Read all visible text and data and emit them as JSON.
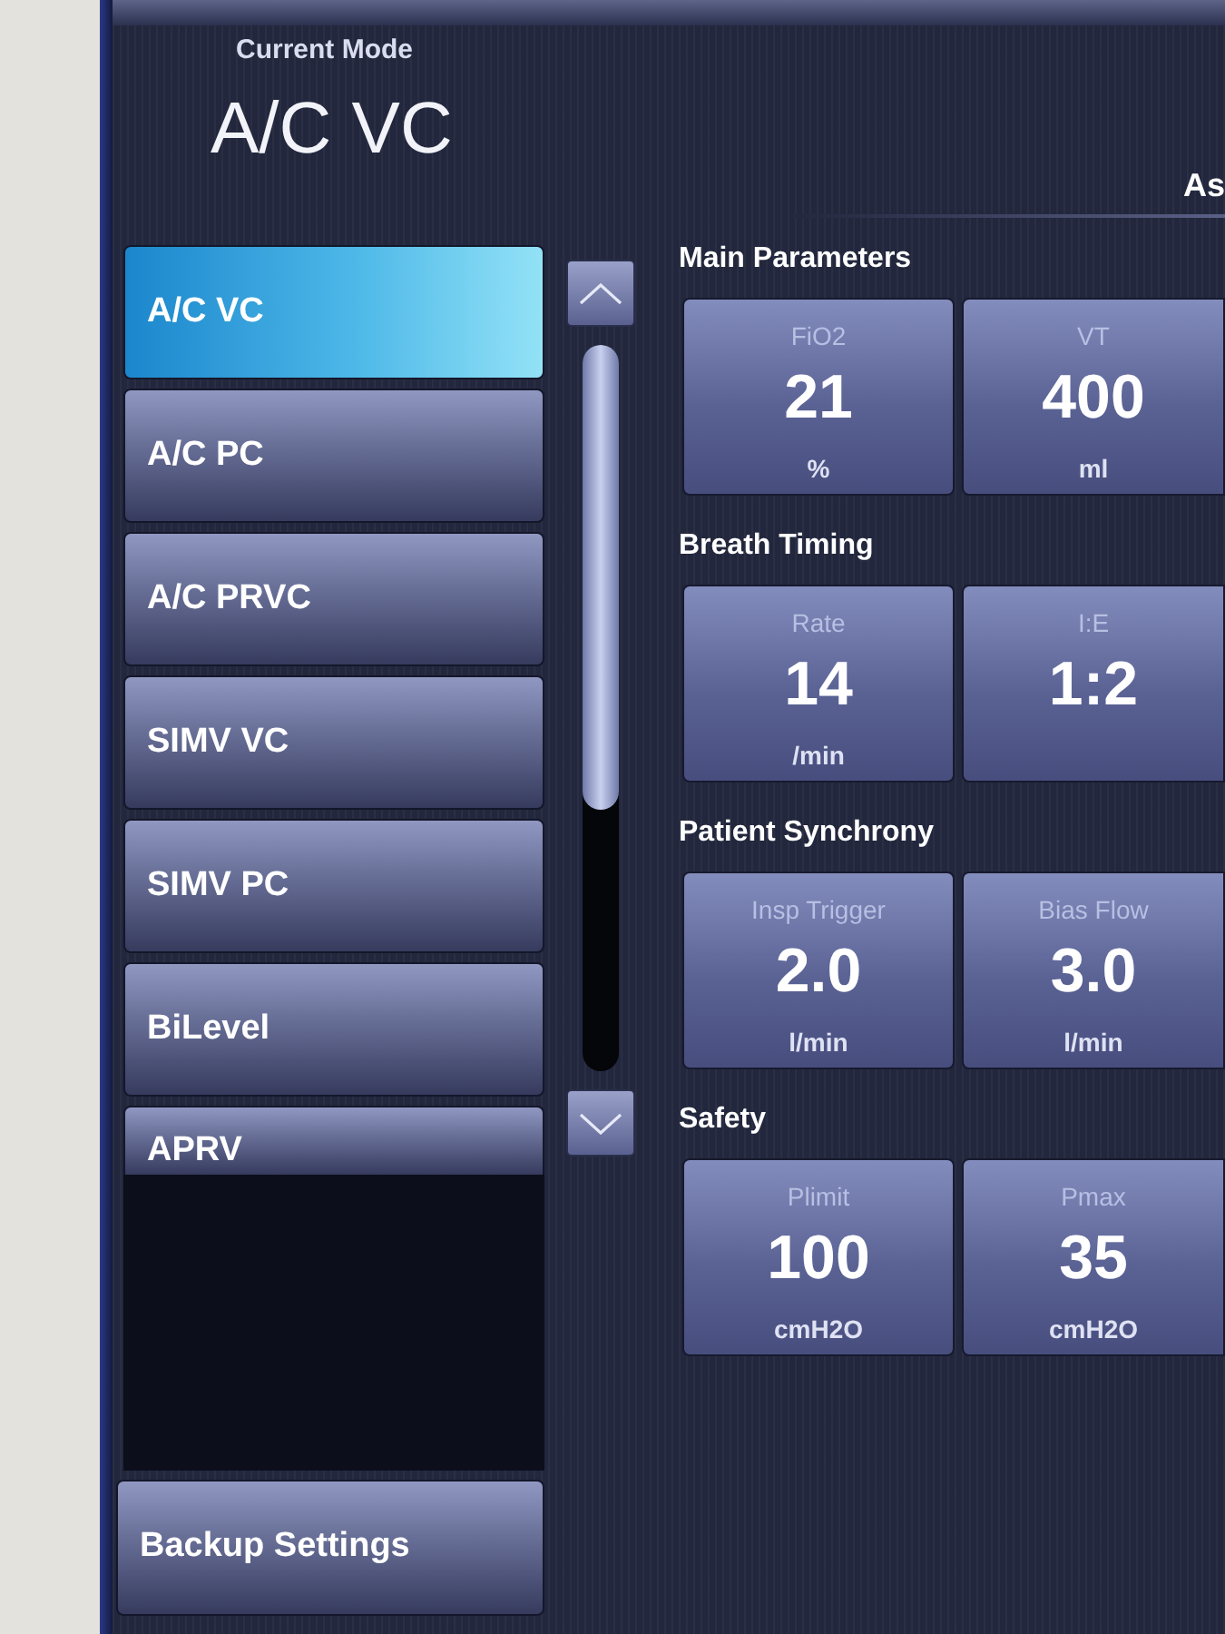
{
  "header": {
    "caption": "Current Mode",
    "mode": "A/C VC",
    "right_text": "As"
  },
  "modes": [
    {
      "label": "A/C VC",
      "selected": true,
      "kind": "full"
    },
    {
      "label": "A/C PC",
      "selected": false,
      "kind": "full"
    },
    {
      "label": "A/C PRVC",
      "selected": false,
      "kind": "full"
    },
    {
      "label": "SIMV VC",
      "selected": false,
      "kind": "full"
    },
    {
      "label": "SIMV PC",
      "selected": false,
      "kind": "full"
    },
    {
      "label": "BiLevel",
      "selected": false,
      "kind": "full"
    },
    {
      "label": "APRV",
      "selected": false,
      "kind": "partial"
    }
  ],
  "backup_button": "Backup Settings",
  "sections": [
    {
      "title": "Main Parameters",
      "tiles": [
        {
          "label": "FiO2",
          "value": "21",
          "unit": "%"
        },
        {
          "label": "VT",
          "value": "400",
          "unit": "ml"
        }
      ]
    },
    {
      "title": "Breath Timing",
      "tiles": [
        {
          "label": "Rate",
          "value": "14",
          "unit": "/min"
        },
        {
          "label": "I:E",
          "value": "1:2"
        }
      ]
    },
    {
      "title": "Patient Synchrony",
      "tiles": [
        {
          "label": "Insp Trigger",
          "value": "2.0",
          "unit": "l/min"
        },
        {
          "label": "Bias Flow",
          "value": "3.0",
          "unit": "l/min"
        }
      ]
    },
    {
      "title": "Safety",
      "tiles": [
        {
          "label": "Plimit",
          "value": "100",
          "unit": "cmH2O"
        },
        {
          "label": "Pmax",
          "value": "35",
          "unit": "cmH2O"
        }
      ]
    }
  ]
}
